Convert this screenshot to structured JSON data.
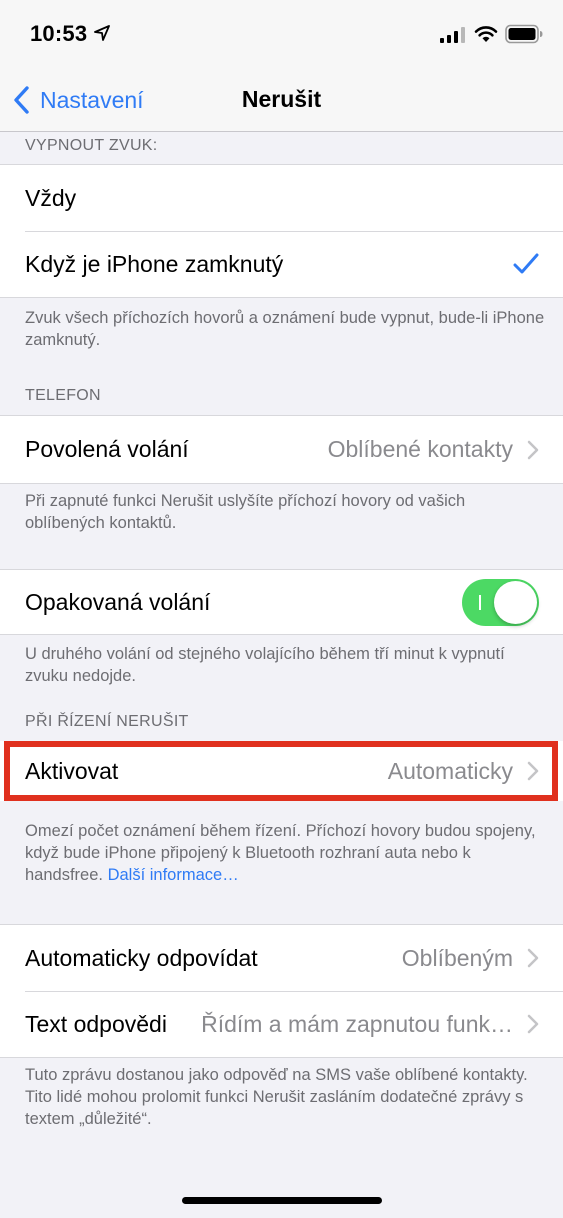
{
  "status_bar": {
    "time": "10:53"
  },
  "nav": {
    "back_label": "Nastavení",
    "title": "Nerušit"
  },
  "silence": {
    "header": "VYPNOUT ZVUK:",
    "options": [
      {
        "label": "Vždy",
        "selected": false
      },
      {
        "label": "Když je iPhone zamknutý",
        "selected": true
      }
    ],
    "footer": "Zvuk všech příchozích hovorů a oznámení bude vypnut, bude-li iPhone zamknutý."
  },
  "phone": {
    "header": "TELEFON",
    "allow_calls": {
      "label": "Povolená volání",
      "value": "Oblíbené kontakty"
    },
    "footer": "Při zapnuté funkci Nerušit uslyšíte příchozí hovory od vašich oblíbených kontaktů."
  },
  "repeated": {
    "label": "Opakovaná volání",
    "enabled": true,
    "footer": "U druhého volání od stejného volajícího během tří minut k vypnutí zvuku nedojde."
  },
  "driving": {
    "header": "PŘI ŘÍZENÍ NERUŠIT",
    "activate": {
      "label": "Aktivovat",
      "value": "Automaticky"
    },
    "footer": "Omezí počet oznámení během řízení. Příchozí hovory budou spojeny, když bude iPhone připojený k Bluetooth rozhraní auta nebo k handsfree.",
    "footer_link": "Další informace…"
  },
  "auto_reply": {
    "reply_to": {
      "label": "Automaticky odpovídat",
      "value": "Oblíbeným"
    },
    "reply_text": {
      "label": "Text odpovědi",
      "value": "Řídím a mám zapnutou funk…"
    },
    "footer": "Tuto zprávu dostanou jako odpověď na SMS vaše oblíbené kontakty. Tito lidé mohou prolomit funkci Nerušit zasláním dodatečné zprávy s textem „důležité“."
  },
  "colors": {
    "accent": "#2f7bf5",
    "toggle_on": "#4cd964",
    "highlight": "#e0301e"
  }
}
